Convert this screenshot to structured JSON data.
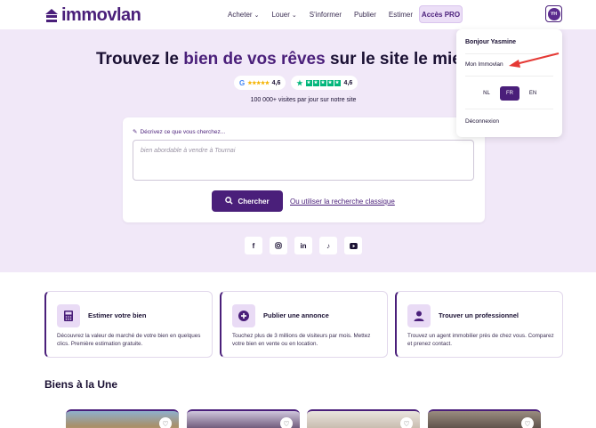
{
  "header": {
    "logo_text": "immovlan",
    "nav": [
      {
        "label": "Acheter",
        "has_dropdown": true
      },
      {
        "label": "Louer",
        "has_dropdown": true
      },
      {
        "label": "S'informer",
        "has_dropdown": false
      },
      {
        "label": "Publier",
        "has_dropdown": false
      },
      {
        "label": "Estimer",
        "has_dropdown": false
      }
    ],
    "pro_label": "Accès PRO",
    "avatar_initials": "YH"
  },
  "hero": {
    "title_pre": "Trouvez le ",
    "title_highlight": "bien de vos rêves",
    "title_post": " sur le site le mieux",
    "google_rating": "4,6",
    "trustpilot_rating": "4,6",
    "visits_text": "100 000+ visites par jour sur notre site"
  },
  "search": {
    "label": "Décrivez ce que vous cherchez...",
    "placeholder": "bien abordable à vendre à Tournai",
    "button_label": "Chercher",
    "classic_link": "Ou utiliser la recherche classique"
  },
  "socials": [
    "facebook-icon",
    "instagram-icon",
    "linkedin-icon",
    "tiktok-icon",
    "youtube-icon"
  ],
  "features": [
    {
      "title": "Estimer votre bien",
      "desc": "Découvrez la valeur de marché de votre bien en quelques clics. Première estimation gratuite.",
      "icon": "calculator-icon"
    },
    {
      "title": "Publier une annonce",
      "desc": "Touchez plus de 3 millions de visiteurs par mois. Mettez votre bien en vente ou en location.",
      "icon": "plus-circle-icon"
    },
    {
      "title": "Trouver un professionnel",
      "desc": "Trouvez un agent immobilier près de chez vous. Comparez et prenez contact.",
      "icon": "agent-icon"
    }
  ],
  "featured_title": "Biens à la Une",
  "dropdown": {
    "greeting": "Bonjour Yasmine",
    "my_account": "Mon Immovlan",
    "languages": [
      "NL",
      "FR",
      "EN"
    ],
    "active_language": "FR",
    "logout": "Déconnexion"
  },
  "colors": {
    "brand": "#4a1f7a",
    "hero_bg": "#f1e8f8",
    "annotation_arrow": "#e53935"
  }
}
